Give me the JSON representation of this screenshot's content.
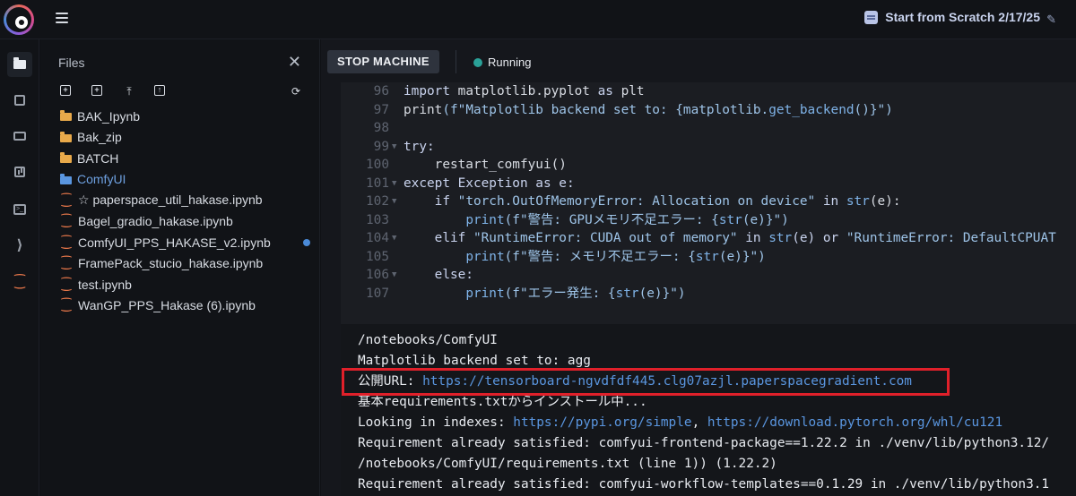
{
  "header": {
    "notebook_title": "Start from Scratch 2/17/25"
  },
  "rail": {
    "items": [
      "folder-icon",
      "cpu-icon",
      "stack-icon",
      "chart-icon",
      "terminal-icon",
      "vscode-icon",
      "jupyter-icon"
    ]
  },
  "files_panel": {
    "title": "Files",
    "items": [
      {
        "name": "BAK_Ipynb",
        "type": "folder"
      },
      {
        "name": "Bak_zip",
        "type": "folder"
      },
      {
        "name": "BATCH",
        "type": "folder"
      },
      {
        "name": "ComfyUI",
        "type": "folder",
        "selected": true
      },
      {
        "name": "☆ paperspace_util_hakase.ipynb",
        "type": "notebook"
      },
      {
        "name": "Bagel_gradio_hakase.ipynb",
        "type": "notebook"
      },
      {
        "name": "ComfyUI_PPS_HAKASE_v2.ipynb",
        "type": "notebook",
        "modified": true
      },
      {
        "name": "FramePack_stucio_hakase.ipynb",
        "type": "notebook"
      },
      {
        "name": "test.ipynb",
        "type": "notebook"
      },
      {
        "name": "WanGP_PPS_Hakase (6).ipynb",
        "type": "notebook"
      }
    ]
  },
  "toolbar": {
    "stop_label": "STOP MACHINE",
    "status_label": "Running",
    "status_color": "#2aa198"
  },
  "code": {
    "lines": [
      {
        "n": "96",
        "fold": false
      },
      {
        "n": "97",
        "fold": false
      },
      {
        "n": "98",
        "fold": false
      },
      {
        "n": "99",
        "fold": true
      },
      {
        "n": "100",
        "fold": false
      },
      {
        "n": "101",
        "fold": true
      },
      {
        "n": "102",
        "fold": true
      },
      {
        "n": "103",
        "fold": false
      },
      {
        "n": "104",
        "fold": true
      },
      {
        "n": "105",
        "fold": false
      },
      {
        "n": "106",
        "fold": true
      },
      {
        "n": "107",
        "fold": false
      }
    ],
    "text": {
      "l96_a": "import ",
      "l96_b": "matplotlib.pyplot ",
      "l96_c": "as ",
      "l96_d": "plt",
      "l97_a": "print",
      "l97_b": "(f\"Matplotlib backend set to: {matplotlib.",
      "l97_c": "get_backend",
      "l97_d": "()}\")",
      "l99": "try:",
      "l100_a": "    ",
      "l100_b": "restart_comfyui()",
      "l101": "except Exception as e:",
      "l102_a": "    if ",
      "l102_b": "\"torch.OutOfMemoryError: Allocation on device\"",
      "l102_c": " in ",
      "l102_d": "str",
      "l102_e": "(e):",
      "l103_a": "        ",
      "l103_b": "print",
      "l103_c": "(f\"警告: GPUメモリ不足エラー: {",
      "l103_d": "str",
      "l103_e": "(e)}\")",
      "l104_a": "    elif ",
      "l104_b": "\"RuntimeError: CUDA out of memory\"",
      "l104_c": " in ",
      "l104_d": "str",
      "l104_e": "(e) or ",
      "l104_f": "\"RuntimeError: DefaultCPUAT",
      "l105_a": "        ",
      "l105_b": "print",
      "l105_c": "(f\"警告: メモリ不足エラー: {",
      "l105_d": "str",
      "l105_e": "(e)}\")",
      "l106": "    else:",
      "l107_a": "        ",
      "l107_b": "print",
      "l107_c": "(f\"エラー発生: {",
      "l107_d": "str",
      "l107_e": "(e)}\")"
    }
  },
  "output": {
    "line1": "/notebooks/ComfyUI",
    "line2": "Matplotlib backend set to: agg",
    "line3_prefix": "公開URL: ",
    "line3_link": "https://tensorboard-ngvdfdf445.clg07azjl.paperspacegradient.com",
    "line4": "基本requirements.txtからインストール中...",
    "line5_prefix": "Looking in indexes: ",
    "line5_link1": "https://pypi.org/simple",
    "line5_sep": ", ",
    "line5_link2": "https://download.pytorch.org/whl/cu121",
    "line6": "Requirement already satisfied: comfyui-frontend-package==1.22.2 in ./venv/lib/python3.12/",
    "line7": "/notebooks/ComfyUI/requirements.txt (line 1)) (1.22.2)",
    "line8": "Requirement already satisfied: comfyui-workflow-templates==0.1.29 in ./venv/lib/python3.1"
  },
  "colors": {
    "highlight_border": "#e0202a",
    "link": "#5a96e0",
    "folder": "#e8a94a",
    "selected_folder": "#5a96e0"
  }
}
